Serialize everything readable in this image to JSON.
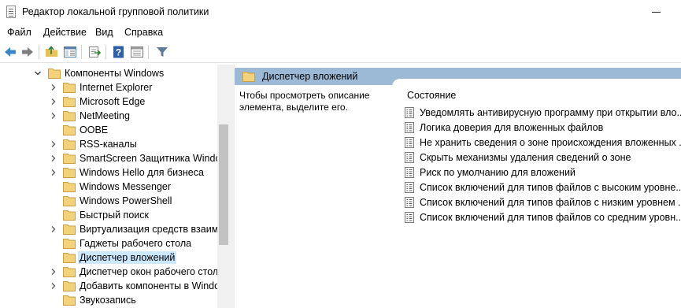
{
  "window": {
    "title": "Редактор локальной групповой политики"
  },
  "menu": [
    "Файл",
    "Действие",
    "Вид",
    "Справка"
  ],
  "tree": {
    "parent": "Компоненты Windows",
    "items": [
      "Internet Explorer",
      "Microsoft Edge",
      "NetMeeting",
      "OOBE",
      "RSS-каналы",
      "SmartScreen Защитника Window",
      "Windows Hello для бизнеса",
      "Windows Messenger",
      "Windows PowerShell",
      "Быстрый поиск",
      "Виртуализация средств взаимод",
      "Гаджеты рабочего стола",
      "Диспетчер вложений",
      "Диспетчер окон рабочего стола",
      "Добавить компоненты в Window",
      "Звукозапись"
    ],
    "selected": "Диспетчер вложений"
  },
  "right_panel": {
    "header": "Диспетчер вложений",
    "description": "Чтобы просмотреть описание элемента, выделите его.",
    "column": "Состояние",
    "policies": [
      "Уведомлять антивирусную программу при открытии вло...",
      "Логика доверия для вложенных файлов",
      "Не хранить сведения о зоне происхождения вложенных ...",
      "Скрыть механизмы удаления сведений о зоне",
      "Риск по умолчанию для вложений",
      "Список включений для типов файлов с высоким уровне...",
      "Список включений для типов файлов с низким уровнем ...",
      "Список включений для типов файлов со средним уровн..."
    ]
  },
  "colors": {
    "header_bg": "#9cb9d6",
    "selected_bg": "#cce8ff",
    "folder": "#e8c15a"
  }
}
